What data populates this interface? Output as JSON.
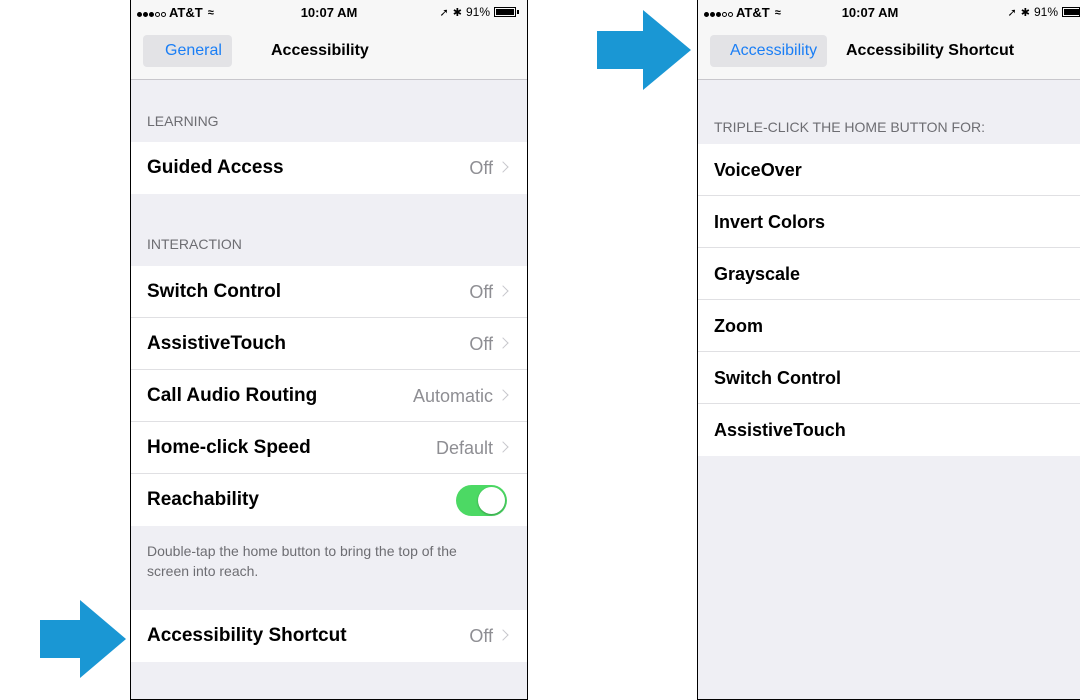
{
  "colors": {
    "accent": "#1a7ef5",
    "arrow": "#1a97d4",
    "toggle_on": "#4cd964",
    "group_bg": "#efeff4"
  },
  "left_phone": {
    "status": {
      "carrier": "AT&T",
      "time": "10:07 AM",
      "battery": "91%"
    },
    "nav": {
      "back_label": "General",
      "title": "Accessibility"
    },
    "learning": {
      "header": "LEARNING",
      "rows": [
        {
          "label": "Guided Access",
          "value": "Off"
        }
      ]
    },
    "interaction": {
      "header": "INTERACTION",
      "rows": [
        {
          "label": "Switch Control",
          "value": "Off"
        },
        {
          "label": "AssistiveTouch",
          "value": "Off"
        },
        {
          "label": "Call Audio Routing",
          "value": "Automatic"
        },
        {
          "label": "Home-click Speed",
          "value": "Default"
        }
      ],
      "reachability": {
        "label": "Reachability",
        "on": true
      },
      "note": "Double-tap the home button to bring the top of the screen into reach."
    },
    "shortcut_row": {
      "label": "Accessibility Shortcut",
      "value": "Off"
    }
  },
  "right_phone": {
    "status": {
      "carrier": "AT&T",
      "time": "10:07 AM",
      "battery": "91%"
    },
    "nav": {
      "back_label": "Accessibility",
      "title": "Accessibility Shortcut"
    },
    "header": "TRIPLE-CLICK THE HOME BUTTON FOR:",
    "options": [
      {
        "label": "VoiceOver"
      },
      {
        "label": "Invert Colors"
      },
      {
        "label": "Grayscale"
      },
      {
        "label": "Zoom"
      },
      {
        "label": "Switch Control"
      },
      {
        "label": "AssistiveTouch"
      }
    ]
  }
}
